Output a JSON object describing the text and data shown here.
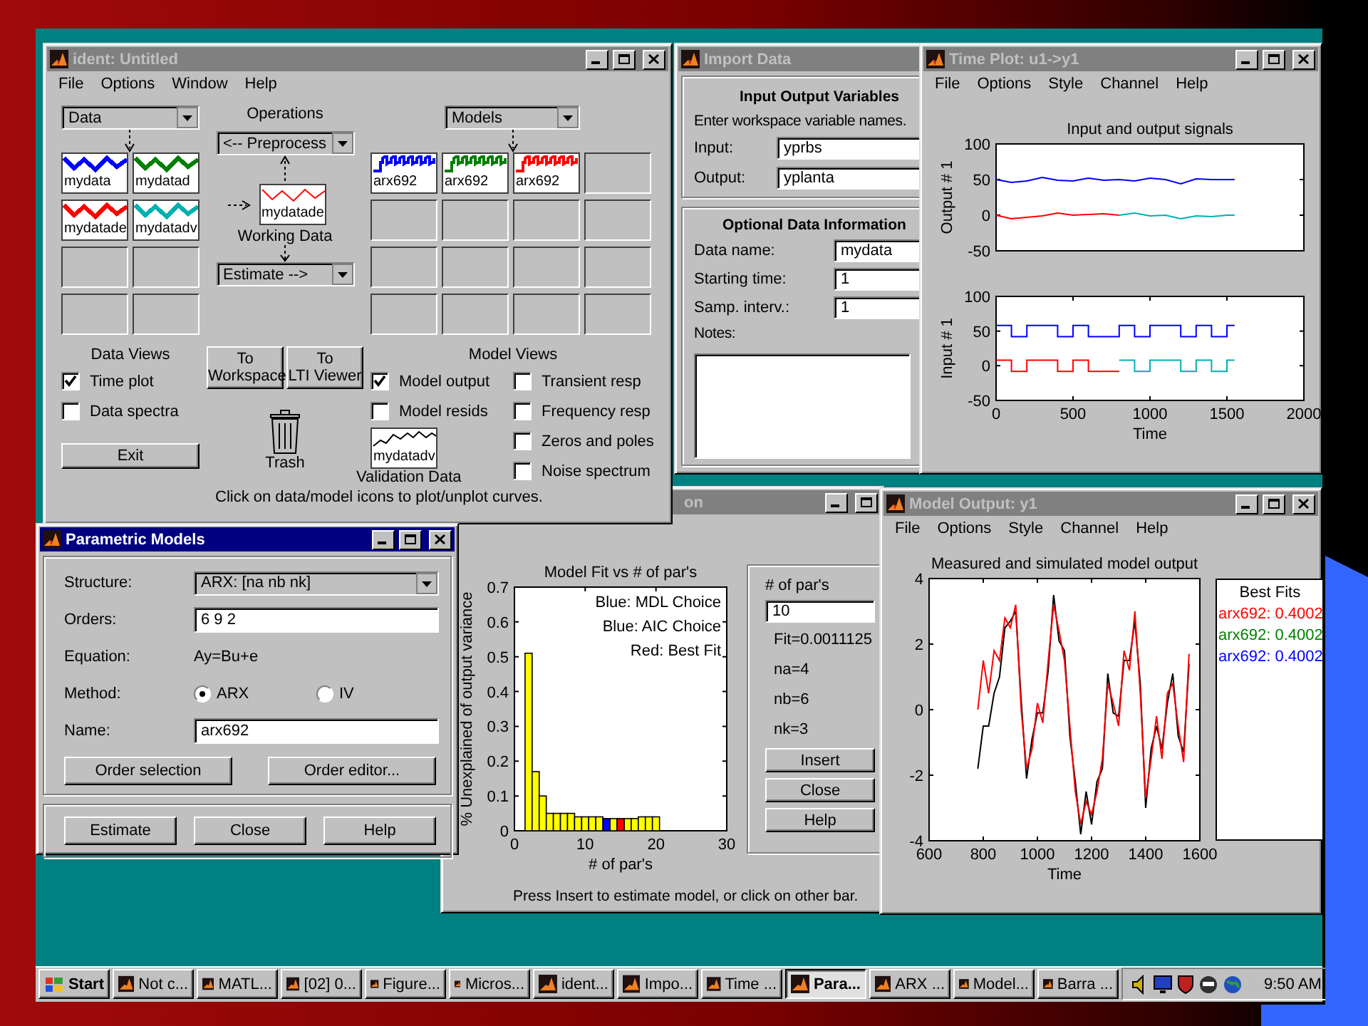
{
  "ident": {
    "title": "ident: Untitled",
    "active": false,
    "menu": [
      "File",
      "Options",
      "Window",
      "Help"
    ],
    "data_dropdown": "Data",
    "models_dropdown": "Models",
    "operations_label": "Operations",
    "preprocess": "<-- Preprocess",
    "working_data": {
      "name": "mydatade",
      "label": "Working Data"
    },
    "estimate": "Estimate -->",
    "data_sets": [
      {
        "name": "mydata",
        "color": "#0000ff"
      },
      {
        "name": "mydatad",
        "color": "#008000"
      },
      {
        "name": "mydatade",
        "color": "#ff0000"
      },
      {
        "name": "mydatadv",
        "color": "#00b0b0"
      }
    ],
    "models": [
      {
        "name": "arx692",
        "color": "#0000ff"
      },
      {
        "name": "arx692",
        "color": "#008000"
      },
      {
        "name": "arx692",
        "color": "#ff0000"
      }
    ],
    "data_views": {
      "label": "Data Views",
      "options": [
        {
          "label": "Time plot",
          "checked": true
        },
        {
          "label": "Data spectra",
          "checked": false
        }
      ]
    },
    "to_workspace": "To\nWorkspace",
    "to_lti": "To\nLTI Viewer",
    "trash": "Trash",
    "validation_data": {
      "name": "mydatadv",
      "label": "Validation Data"
    },
    "model_views": {
      "label": "Model Views",
      "options": [
        {
          "label": "Model output",
          "checked": true
        },
        {
          "label": "Model resids",
          "checked": false
        },
        {
          "label": "Transient resp",
          "checked": false
        },
        {
          "label": "Frequency resp",
          "checked": false
        },
        {
          "label": "Zeros and poles",
          "checked": false
        },
        {
          "label": "Noise spectrum",
          "checked": false
        }
      ]
    },
    "exit": "Exit",
    "hint": "Click on data/model icons to plot/unplot curves."
  },
  "import_data": {
    "title": "Import Data",
    "active": false,
    "heading": "Input Output Variables",
    "hint": "Enter workspace variable names.",
    "variables": [
      {
        "label": "Input:",
        "value": "yprbs"
      },
      {
        "label": "Output:",
        "value": "yplanta"
      }
    ],
    "optional_heading": "Optional Data Information",
    "info": [
      {
        "label": "Data name:",
        "value": "mydata"
      },
      {
        "label": "Starting time:",
        "value": "1"
      },
      {
        "label": "Samp. interv.:",
        "value": "1"
      }
    ],
    "notes_label": "Notes:"
  },
  "time_plot": {
    "title": "Time Plot: u1->y1",
    "active": false,
    "menu": [
      "File",
      "Options",
      "Style",
      "Channel",
      "Help"
    ],
    "output_chart": {
      "chart_data": {
        "type": "line",
        "title": "Input and output signals",
        "ylabel": "Output # 1",
        "x": [
          0,
          100,
          200,
          300,
          400,
          500,
          600,
          700,
          800,
          900,
          1000,
          1100,
          1200,
          1300,
          1400,
          1500,
          1550
        ],
        "series": [
          {
            "color": "#0000ff",
            "values": [
              50,
              46,
              48,
              53,
              49,
              48,
              52,
              49,
              50,
              48,
              52,
              50,
              44,
              51,
              50,
              50,
              50
            ]
          },
          {
            "color": "#ff0000",
            "values": [
              0,
              -5,
              -3,
              -1,
              3,
              0,
              1,
              2,
              0,
              null,
              null,
              null,
              null,
              null,
              null,
              null,
              null
            ]
          },
          {
            "color": "#00b0b0",
            "values": [
              null,
              null,
              null,
              null,
              null,
              null,
              null,
              null,
              0,
              3,
              -1,
              0,
              -5,
              -1,
              -2,
              0,
              0
            ]
          }
        ],
        "xlim": [
          0,
          2000
        ],
        "ylim": [
          -50,
          100
        ],
        "yticks": [
          -50,
          0,
          50,
          100
        ]
      }
    },
    "input_chart": {
      "chart_data": {
        "type": "line",
        "xlabel": "Time",
        "ylabel": "Input # 1",
        "x": [
          0,
          100,
          100,
          200,
          200,
          300,
          300,
          400,
          400,
          500,
          500,
          600,
          600,
          700,
          700,
          800,
          800,
          900,
          900,
          1000,
          1000,
          1100,
          1100,
          1200,
          1200,
          1300,
          1300,
          1400,
          1400,
          1500,
          1500,
          1550
        ],
        "series": [
          {
            "color": "#0000ff",
            "values": [
              58,
              58,
              42,
              42,
              58,
              58,
              58,
              58,
              42,
              42,
              58,
              58,
              42,
              42,
              42,
              42,
              58,
              58,
              42,
              42,
              58,
              58,
              58,
              58,
              42,
              42,
              58,
              58,
              42,
              42,
              58,
              58
            ]
          },
          {
            "color": "#ff0000",
            "values": [
              8,
              8,
              -8,
              -8,
              8,
              8,
              8,
              8,
              -8,
              -8,
              8,
              8,
              -8,
              -8,
              -8,
              -8,
              null,
              null,
              null,
              null,
              null,
              null,
              null,
              null,
              null,
              null,
              null,
              null,
              null,
              null,
              null,
              null
            ]
          },
          {
            "color": "#00b0b0",
            "values": [
              null,
              null,
              null,
              null,
              null,
              null,
              null,
              null,
              null,
              null,
              null,
              null,
              null,
              null,
              null,
              null,
              8,
              8,
              -8,
              -8,
              8,
              8,
              8,
              8,
              -8,
              -8,
              8,
              8,
              -8,
              -8,
              8,
              8
            ]
          }
        ],
        "xlim": [
          0,
          2000
        ],
        "ylim": [
          -50,
          100
        ],
        "xticks": [
          0,
          500,
          1000,
          1500,
          2000
        ],
        "yticks": [
          -50,
          0,
          50,
          100
        ]
      }
    }
  },
  "order_window": {
    "title": "on",
    "active": false,
    "chart_data": {
      "type": "bar",
      "title": "Model Fit vs # of par's",
      "xlabel": "# of par's",
      "ylabel": "% Unexplained of output variance",
      "x": [
        2,
        3,
        4,
        5,
        6,
        7,
        8,
        9,
        10,
        11,
        12,
        13,
        14,
        15,
        16,
        17,
        18,
        19,
        20
      ],
      "series": [
        {
          "color": "#ffff00",
          "values": [
            0.51,
            0.17,
            0.1,
            0.05,
            0.05,
            0.05,
            0.05,
            0.04,
            0.04,
            0.04,
            0.04,
            null,
            0.035,
            null,
            0.035,
            0.035,
            0.04,
            0.04,
            0.04
          ]
        },
        {
          "color": "#0000ff",
          "values": [
            null,
            null,
            null,
            null,
            null,
            null,
            null,
            null,
            null,
            null,
            null,
            0.035,
            null,
            null,
            null,
            null,
            null,
            null,
            null
          ]
        },
        {
          "color": "#ff0000",
          "values": [
            null,
            null,
            null,
            null,
            null,
            null,
            null,
            null,
            null,
            null,
            null,
            null,
            null,
            0.035,
            null,
            null,
            null,
            null,
            null
          ]
        }
      ],
      "xlim": [
        0,
        30
      ],
      "ylim": [
        0,
        0.7
      ],
      "xticks": [
        0,
        10,
        20,
        30
      ],
      "yticks": [
        0,
        0.1,
        0.2,
        0.3,
        0.4,
        0.5,
        0.6,
        0.7
      ],
      "annotations": [
        "Blue: MDL Choice",
        "Blue: AIC Choice",
        "Red: Best Fit"
      ]
    },
    "panel": {
      "label": "# of par's",
      "value": "10",
      "stats": [
        "Fit=0.0011125",
        "na=4",
        "nb=6",
        "nk=3"
      ],
      "buttons": [
        "Insert",
        "Close",
        "Help"
      ]
    },
    "status": "Press Insert to estimate model, or click on other bar."
  },
  "model_output": {
    "title": "Model Output: y1",
    "active": false,
    "menu": [
      "File",
      "Options",
      "Style",
      "Channel",
      "Help"
    ],
    "chart_data": {
      "type": "line",
      "title": "Measured and simulated model output",
      "xlabel": "Time",
      "x": [
        780,
        800,
        820,
        840,
        860,
        880,
        900,
        920,
        940,
        960,
        980,
        1000,
        1020,
        1040,
        1060,
        1080,
        1100,
        1120,
        1140,
        1160,
        1180,
        1200,
        1220,
        1240,
        1260,
        1280,
        1300,
        1320,
        1340,
        1360,
        1380,
        1400,
        1420,
        1440,
        1460,
        1480,
        1500,
        1520,
        1540,
        1560
      ],
      "series": [
        {
          "color": "#000000",
          "values": [
            -1.8,
            -0.5,
            -0.5,
            0.5,
            1,
            2.5,
            2.7,
            3,
            0.3,
            -2.1,
            -0.9,
            -0.1,
            -0.1,
            1.2,
            3.5,
            2.1,
            1.8,
            -0.8,
            -2.2,
            -3.8,
            -2.5,
            -3.5,
            -2.2,
            -1.8,
            1.1,
            -0.1,
            -0.2,
            1.5,
            1.5,
            2.7,
            0.8,
            -3,
            -1.2,
            -0.5,
            -1.2,
            0.2,
            1.1,
            -0.8,
            -1.3,
            1.4
          ]
        },
        {
          "color": "#ff0000",
          "values": [
            0,
            1.5,
            0.5,
            1.8,
            1.5,
            2.8,
            2.5,
            3.2,
            0,
            -1.8,
            -1.2,
            0.2,
            -0.4,
            1.5,
            3.2,
            2.4,
            1.5,
            -0.5,
            -2.5,
            -3.5,
            -2.8,
            -3.2,
            -2.5,
            -1.5,
            0.8,
            0.2,
            -0.5,
            1.8,
            1.2,
            3,
            0.5,
            -2.7,
            -1.5,
            -0.2,
            -1.5,
            0.5,
            0.8,
            -0.5,
            -1.6,
            1.7
          ]
        }
      ],
      "xlim": [
        600,
        1600
      ],
      "ylim": [
        -4,
        4
      ],
      "xticks": [
        600,
        800,
        1000,
        1200,
        1400,
        1600
      ],
      "yticks": [
        -4,
        -2,
        0,
        2,
        4
      ]
    },
    "legend": {
      "title": "Best Fits",
      "entries": [
        {
          "label": "arx692: 0.4002",
          "color": "#ff0000"
        },
        {
          "label": "arx692: 0.4002",
          "color": "#008000"
        },
        {
          "label": "arx692: 0.4002",
          "color": "#0000ff"
        }
      ]
    }
  },
  "parametric": {
    "title": "Parametric Models",
    "active": true,
    "structure": {
      "label": "Structure:",
      "value": "ARX: [na nb nk]"
    },
    "orders": {
      "label": "Orders:",
      "value": "6 9 2"
    },
    "equation": {
      "label": "Equation:",
      "value": "Ay=Bu+e"
    },
    "method": {
      "label": "Method:",
      "options": [
        {
          "label": "ARX",
          "selected": true
        },
        {
          "label": "IV",
          "selected": false
        }
      ]
    },
    "name": {
      "label": "Name:",
      "value": "arx692"
    },
    "buttons": [
      "Order selection",
      "Order editor..."
    ],
    "footer_buttons": [
      "Estimate",
      "Close",
      "Help"
    ]
  },
  "taskbar": {
    "start": "Start",
    "tasks": [
      {
        "label": "Not c...",
        "selected": false
      },
      {
        "label": "MATL...",
        "selected": false
      },
      {
        "label": "[02] 0...",
        "selected": false
      },
      {
        "label": "Figure...",
        "selected": false
      },
      {
        "label": "Micros...",
        "selected": false
      },
      {
        "label": "ident...",
        "selected": false
      },
      {
        "label": "Impo...",
        "selected": false
      },
      {
        "label": "Time ...",
        "selected": false
      },
      {
        "label": "Para...",
        "selected": true
      },
      {
        "label": "ARX ...",
        "selected": false
      },
      {
        "label": "Model...",
        "selected": false
      },
      {
        "label": "Barra ...",
        "selected": false
      }
    ],
    "clock": "9:50 AM"
  }
}
